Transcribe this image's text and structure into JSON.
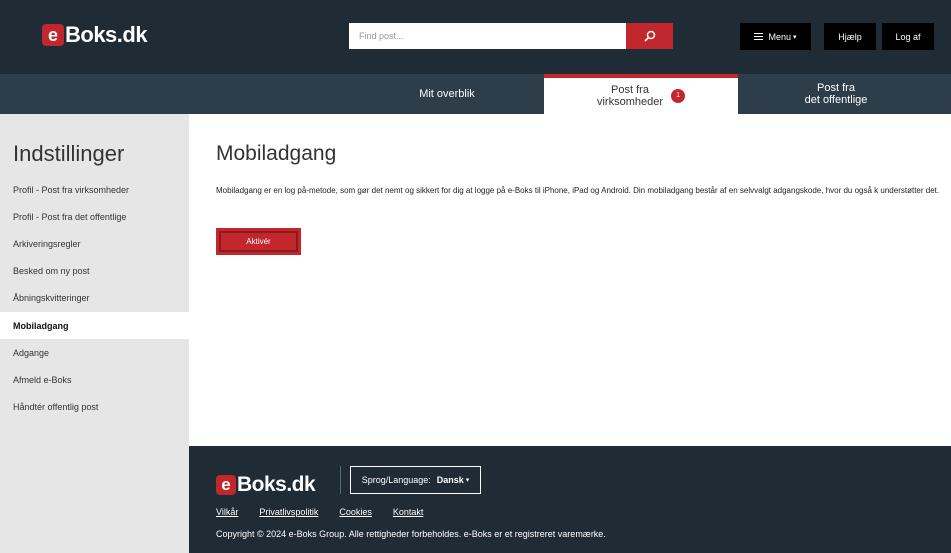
{
  "brand": {
    "logo_letter": "e",
    "logo_text": "Boks.dk"
  },
  "header": {
    "search_placeholder": "Find post...",
    "menu_label": "Menu",
    "menu_caret": "▾",
    "help_label": "Hjælp",
    "logout_label": "Log af"
  },
  "nav": {
    "tabs": [
      {
        "line1": "Mit overblik",
        "line2": ""
      },
      {
        "line1": "Post fra",
        "line2": "virksomheder",
        "badge": "1"
      },
      {
        "line1": "Post fra",
        "line2": "det offentlige"
      }
    ]
  },
  "sidebar": {
    "title": "Indstillinger",
    "items": [
      {
        "label": "Profil - Post fra virksomheder"
      },
      {
        "label": "Profil - Post fra det offentlige"
      },
      {
        "label": "Arkiveringsregler"
      },
      {
        "label": "Besked om ny post"
      },
      {
        "label": "Åbningskvitteringer"
      },
      {
        "label": "Mobiladgang",
        "active": true
      },
      {
        "label": "Adgange"
      },
      {
        "label": "Afmeld e-Boks"
      },
      {
        "label": "Håndtér offentlig post"
      }
    ]
  },
  "main": {
    "title": "Mobiladgang",
    "description": "Mobiladgang er en log på-metode, som gør det nemt og sikkert for dig at logge på e-Boks til iPhone, iPad og Android. Din mobiladgang består af en selvvalgt adgangskode, hvor du også k understøtter det.",
    "activate_label": "Aktivér"
  },
  "footer": {
    "language_label": "Sprog/Language:",
    "language_value": "Dansk",
    "language_caret": "▾",
    "links": [
      "Vilkår",
      "Privatlivspolitik",
      "Cookies",
      "Kontakt"
    ],
    "copyright": "Copyright © 2024 e-Boks Group. Alle rettigheder forbeholdes. e-Boks er et registreret varemærke."
  },
  "colors": {
    "brand_red": "#c2272d",
    "header_bg": "#1f2b35",
    "nav_bg": "#2d3d4a",
    "sidebar_bg": "#e6e6e6"
  }
}
